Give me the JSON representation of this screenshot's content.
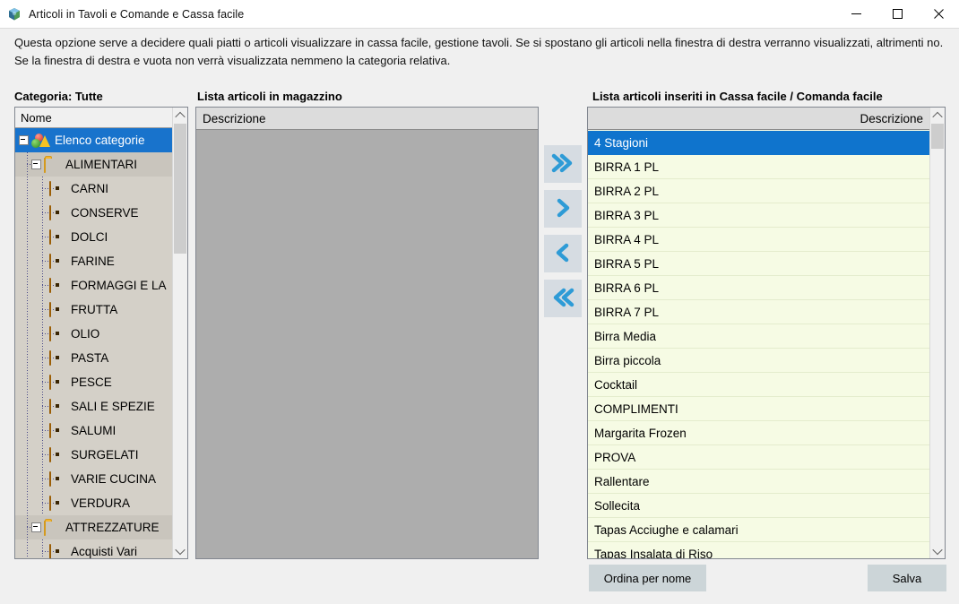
{
  "window": {
    "title": "Articoli in Tavoli e Comande e Cassa facile",
    "app_icon": "cube-globe-icon",
    "minimize_label": "—",
    "maximize_label": "□",
    "close_label": "✕"
  },
  "description": "Questa opzione serve a decidere quali piatti o articoli visualizzare in cassa facile, gestione tavoli. Se si spostano gli articoli nella finestra di destra verranno visualizzati, altrimenti no. Se la finestra di destra e vuota non verrà visualizzata nemmeno la categoria relativa.",
  "tree": {
    "label": "Categoria: Tutte",
    "column_header": "Nome",
    "items": [
      {
        "label": "Elenco categorie",
        "level": 0,
        "icon": "category-root-icon",
        "selected": true,
        "expander": true
      },
      {
        "label": "ALIMENTARI",
        "level": 1,
        "icon": "folder-icon",
        "selected": false,
        "expander": true
      },
      {
        "label": "CARNI",
        "level": 2,
        "icon": "box-icon",
        "selected": false,
        "expander": false
      },
      {
        "label": "CONSERVE",
        "level": 2,
        "icon": "box-icon",
        "selected": false,
        "expander": false
      },
      {
        "label": "DOLCI",
        "level": 2,
        "icon": "box-icon",
        "selected": false,
        "expander": false
      },
      {
        "label": "FARINE",
        "level": 2,
        "icon": "box-icon",
        "selected": false,
        "expander": false
      },
      {
        "label": "FORMAGGI E LA",
        "level": 2,
        "icon": "box-icon",
        "selected": false,
        "expander": false
      },
      {
        "label": "FRUTTA",
        "level": 2,
        "icon": "box-icon",
        "selected": false,
        "expander": false
      },
      {
        "label": "OLIO",
        "level": 2,
        "icon": "box-icon",
        "selected": false,
        "expander": false
      },
      {
        "label": "PASTA",
        "level": 2,
        "icon": "box-icon",
        "selected": false,
        "expander": false
      },
      {
        "label": "PESCE",
        "level": 2,
        "icon": "box-icon",
        "selected": false,
        "expander": false
      },
      {
        "label": "SALI E SPEZIE",
        "level": 2,
        "icon": "box-icon",
        "selected": false,
        "expander": false
      },
      {
        "label": "SALUMI",
        "level": 2,
        "icon": "box-icon",
        "selected": false,
        "expander": false
      },
      {
        "label": "SURGELATI",
        "level": 2,
        "icon": "box-icon",
        "selected": false,
        "expander": false
      },
      {
        "label": "VARIE CUCINA",
        "level": 2,
        "icon": "box-icon",
        "selected": false,
        "expander": false
      },
      {
        "label": "VERDURA",
        "level": 2,
        "icon": "box-icon",
        "selected": false,
        "expander": false
      },
      {
        "label": "ATTREZZATURE",
        "level": 1,
        "icon": "folder-icon",
        "selected": false,
        "expander": true
      },
      {
        "label": "Acquisti Vari",
        "level": 2,
        "icon": "box-icon",
        "selected": false,
        "expander": false
      }
    ]
  },
  "middle": {
    "label": "Lista articoli in magazzino",
    "column_header": "Descrizione",
    "rows": []
  },
  "transfer_buttons": [
    {
      "name": "move-all-right-button",
      "icon": "double-chevron-right-icon"
    },
    {
      "name": "move-right-button",
      "icon": "chevron-right-icon"
    },
    {
      "name": "move-left-button",
      "icon": "chevron-left-icon"
    },
    {
      "name": "move-all-left-button",
      "icon": "double-chevron-left-icon"
    }
  ],
  "right": {
    "label": "Lista articoli inseriti in Cassa facile / Comanda facile",
    "column_header": "Descrizione",
    "rows": [
      {
        "label": "4 Stagioni",
        "selected": true
      },
      {
        "label": "BIRRA 1 PL",
        "selected": false
      },
      {
        "label": "BIRRA 2 PL",
        "selected": false
      },
      {
        "label": "BIRRA 3 PL",
        "selected": false
      },
      {
        "label": "BIRRA 4 PL",
        "selected": false
      },
      {
        "label": "BIRRA 5 PL",
        "selected": false
      },
      {
        "label": "BIRRA 6 PL",
        "selected": false
      },
      {
        "label": "BIRRA 7 PL",
        "selected": false
      },
      {
        "label": "Birra Media",
        "selected": false
      },
      {
        "label": "Birra piccola",
        "selected": false
      },
      {
        "label": "Cocktail",
        "selected": false
      },
      {
        "label": "COMPLIMENTI",
        "selected": false
      },
      {
        "label": "Margarita Frozen",
        "selected": false
      },
      {
        "label": "PROVA",
        "selected": false
      },
      {
        "label": "Rallentare",
        "selected": false
      },
      {
        "label": "Sollecita",
        "selected": false
      },
      {
        "label": "Tapas Acciughe e calamari",
        "selected": false
      },
      {
        "label": "Tapas Insalata di Riso",
        "selected": false
      }
    ]
  },
  "buttons": {
    "sort_by_name": "Ordina per nome",
    "save": "Salva"
  },
  "colors": {
    "selection_blue": "#0f74cd",
    "tree_selection_blue": "#1873cc",
    "list_background": "#f6fbe4",
    "disabled_gray": "#adadad",
    "button_face": "#ccd5d8",
    "transfer_button_face": "#d6dce2",
    "chevron_blue": "#2e9bd6"
  }
}
